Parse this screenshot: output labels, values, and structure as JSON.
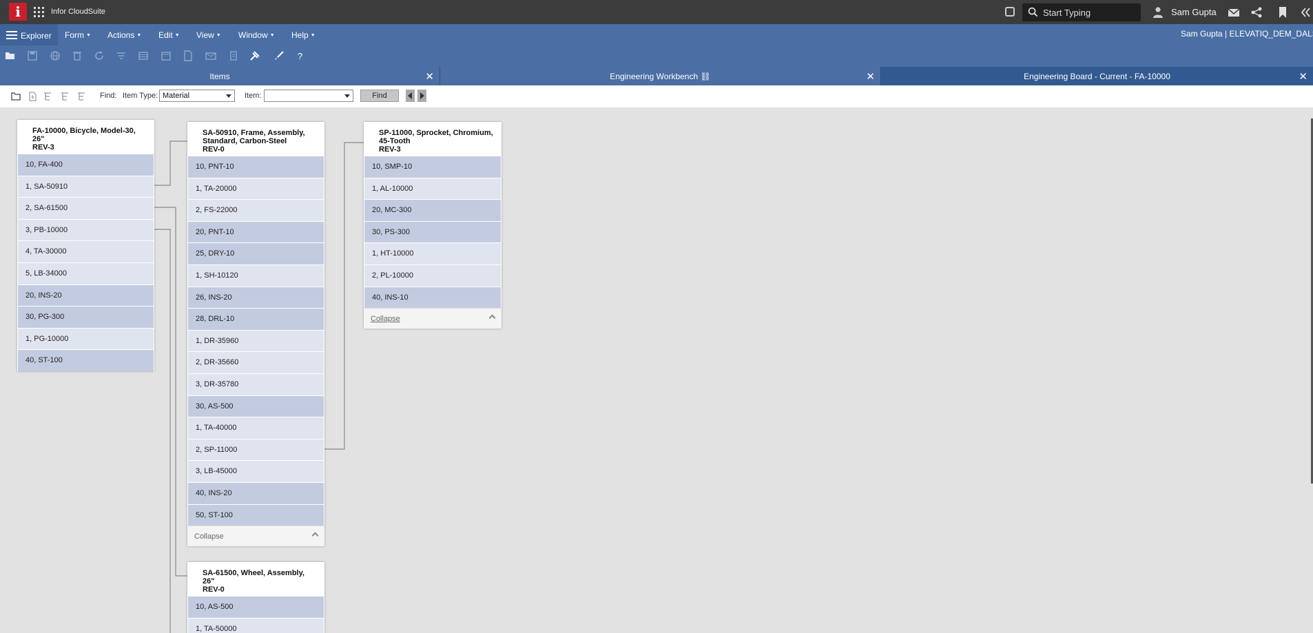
{
  "topbar": {
    "logo_letter": "i",
    "app_title": "Infor CloudSuite",
    "search_placeholder": "Start Typing",
    "user_name": "Sam Gupta"
  },
  "menubar": {
    "explorer_label": "Explorer",
    "menus": [
      "Form",
      "Actions",
      "Edit",
      "View",
      "Window",
      "Help"
    ],
    "session_info": "Sam Gupta | ELEVATIQ_DEM_DALS"
  },
  "tabs": [
    {
      "label": "Items",
      "active": false
    },
    {
      "label": "Engineering Workbench",
      "active": false
    },
    {
      "label": "Engineering Board - Current - FA-10000",
      "active": true
    }
  ],
  "findbar": {
    "find_label": "Find:",
    "item_type_label": "Item Type:",
    "item_type_value": "Material",
    "item_label": "Item:",
    "item_value": "",
    "find_button": "Find"
  },
  "cards": [
    {
      "title": "FA-10000, Bicycle, Model-30, 26\"",
      "rev": "REV-3",
      "rows": [
        "10, FA-400",
        "1, SA-50910",
        "2, SA-61500",
        "3, PB-10000",
        "4, TA-30000",
        "5, LB-34000",
        "20, INS-20",
        "30, PG-300",
        "1, PG-10000",
        "40, ST-100"
      ],
      "dark": [
        true,
        false,
        false,
        false,
        false,
        false,
        true,
        true,
        false,
        true
      ],
      "footer": ""
    },
    {
      "title": "SA-50910, Frame, Assembly, Standard, Carbon-Steel",
      "rev": "REV-0",
      "rows": [
        "10, PNT-10",
        "1, TA-20000",
        "2, FS-22000",
        "20, PNT-10",
        "25, DRY-10",
        "1, SH-10120",
        "26, INS-20",
        "28, DRL-10",
        "1, DR-35960",
        "2, DR-35660",
        "3, DR-35780",
        "30, AS-500",
        "1, TA-40000",
        "2, SP-11000",
        "3, LB-45000",
        "40, INS-20",
        "50, ST-100"
      ],
      "dark": [
        true,
        false,
        false,
        true,
        true,
        false,
        true,
        true,
        false,
        false,
        false,
        true,
        false,
        false,
        false,
        true,
        true
      ],
      "footer": "Collapse"
    },
    {
      "title": "SP-11000, Sprocket, Chromium, 45-Tooth",
      "rev": "REV-3",
      "rows": [
        "10, SMP-10",
        "1, AL-10000",
        "20, MC-300",
        "30, PS-300",
        "1, HT-10000",
        "2, PL-10000",
        "40, INS-10"
      ],
      "dark": [
        true,
        false,
        true,
        true,
        false,
        false,
        true
      ],
      "footer": "Collapse"
    },
    {
      "title": "SA-61500, Wheel, Assembly, 26\"",
      "rev": "REV-0",
      "rows": [
        "10, AS-500",
        "1, TA-50000"
      ],
      "dark": [
        true,
        false
      ],
      "footer": ""
    }
  ],
  "colors": {
    "topbar": "#3c3c3c",
    "menubar": "#4a6fa5",
    "active_tab": "#335a90",
    "row_dark": "#c3cbe0",
    "row_light": "#dfe4ef",
    "logo": "#c8202c"
  },
  "icons": [
    "waffle-icon",
    "search-icon",
    "user-icon",
    "mail-icon",
    "share-icon",
    "bookmark-icon",
    "collapse-icon",
    "folder-open-icon",
    "save-icon",
    "globe-icon",
    "delete-icon",
    "refresh-icon",
    "filter-icon",
    "list-icon",
    "calendar-icon",
    "document-icon",
    "email-icon",
    "attach-icon",
    "tools-icon",
    "brush-icon",
    "help-icon"
  ]
}
